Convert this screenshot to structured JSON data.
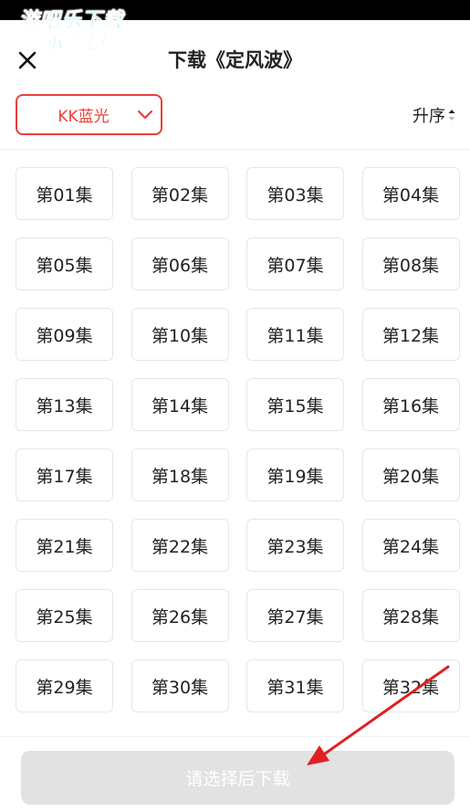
{
  "watermark": {
    "line1": "游吧乐下载",
    "line2": "小编亲测"
  },
  "header": {
    "title": "下载《定风波》",
    "close_icon": "close-icon"
  },
  "quality": {
    "selected": "KK蓝光",
    "chevron_icon": "chevron-down-icon"
  },
  "sort": {
    "label": "升序",
    "icon": "sort-caret-icon"
  },
  "episodes": [
    "第01集",
    "第02集",
    "第03集",
    "第04集",
    "第05集",
    "第06集",
    "第07集",
    "第08集",
    "第09集",
    "第10集",
    "第11集",
    "第12集",
    "第13集",
    "第14集",
    "第15集",
    "第16集",
    "第17集",
    "第18集",
    "第19集",
    "第20集",
    "第21集",
    "第22集",
    "第23集",
    "第24集",
    "第25集",
    "第26集",
    "第27集",
    "第28集",
    "第29集",
    "第30集",
    "第31集",
    "第32集"
  ],
  "footer": {
    "download_label": "请选择后下载"
  },
  "colors": {
    "accent": "#e8403a",
    "disabled_button": "#e2e2e2",
    "watermark": "#2ecbe8",
    "annotation_arrow": "#e02020"
  }
}
